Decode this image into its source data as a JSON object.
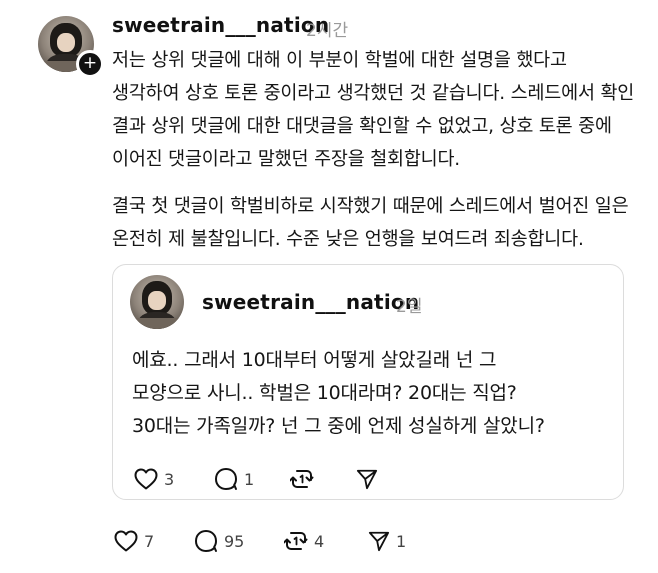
{
  "post": {
    "username": "sweetrain___nation",
    "time": "2시간",
    "follow_symbol": "+",
    "paragraph1": "저는 상위 댓글에 대해 이 부분이 학벌에 대한 설명을 했다고\n생각하여 상호 토론 중이라고 생각했던 것 같습니다. 스레드에서 확인\n결과 상위 댓글에 대한 대댓글을 확인할 수 없었고, 상호 토론 중에\n이어진 댓글이라고 말했던 주장을 철회합니다.",
    "paragraph2": "결국 첫 댓글이 학벌비하로 시작했기 때문에 스레드에서 벌어진 일은\n온전히 제 불찰입니다. 수준 낮은 언행을 보여드려 죄송합니다.",
    "actions": {
      "likes": "7",
      "replies": "95",
      "reposts": "4",
      "shares": "1"
    }
  },
  "quoted": {
    "username": "sweetrain___nation",
    "time": "2일",
    "text": "에효.. 그래서 10대부터 어떻게 살았길래 넌 그\n모양으로 사니.. 학벌은 10대라며? 20대는 직업?\n30대는 가족일까? 넌 그 중에 언제 성실하게 살았니?",
    "actions": {
      "likes": "3",
      "replies": "1"
    }
  },
  "icons": {
    "heart": "heart-icon",
    "reply": "speech-bubble-icon",
    "repost": "repost-icon",
    "share": "paper-plane-icon"
  }
}
